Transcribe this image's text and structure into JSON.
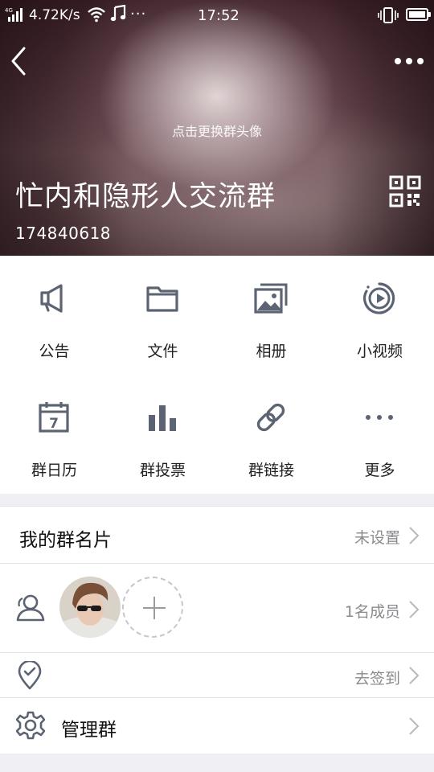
{
  "status_bar": {
    "net_type": "4G",
    "speed": "4.72K/s",
    "dots": "···",
    "time": "17:52",
    "icons": [
      "signal-icon",
      "wifi-icon",
      "music-icon",
      "vibrate-icon",
      "battery-icon"
    ]
  },
  "header": {
    "change_avatar": "点击更换群头像",
    "group_name": "忙内和隐形人交流群",
    "group_id": "174840618",
    "icons": [
      "back-icon",
      "more-icon",
      "qr-code-icon"
    ]
  },
  "grid": [
    {
      "label": "公告",
      "icon": "megaphone-icon"
    },
    {
      "label": "文件",
      "icon": "folder-icon"
    },
    {
      "label": "相册",
      "icon": "album-icon"
    },
    {
      "label": "小视频",
      "icon": "video-icon"
    },
    {
      "label": "群日历",
      "icon": "calendar-icon",
      "calendar_day": "7"
    },
    {
      "label": "群投票",
      "icon": "poll-icon"
    },
    {
      "label": "群链接",
      "icon": "link-icon"
    },
    {
      "label": "更多",
      "icon": "more-dots-icon"
    }
  ],
  "rows": {
    "card": {
      "title": "我的群名片",
      "value": "未设置"
    },
    "members": {
      "value": "1名成员"
    },
    "checkin": {
      "value": "去签到"
    },
    "manage": {
      "title": "管理群"
    }
  },
  "colors": {
    "icon_gray": "#5c6473",
    "divider": "#e4e4e8",
    "secondary_text": "#8a8a8e",
    "page_bg": "#efeff4"
  }
}
